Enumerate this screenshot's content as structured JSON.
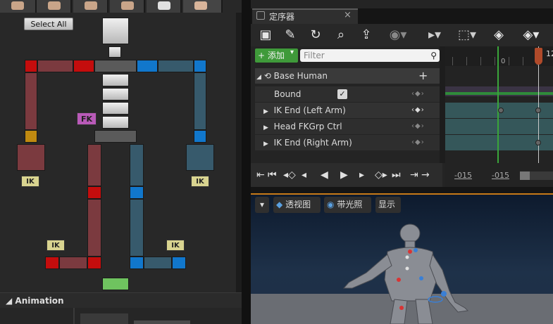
{
  "left_panel": {
    "select_all": "Select All",
    "fk_label": "FK",
    "ik_labels": [
      "IK",
      "IK",
      "IK",
      "IK"
    ],
    "animation_header": "Animation"
  },
  "sequencer": {
    "tab_title": "定序器",
    "close": "×",
    "add_label": "+ 添加",
    "filter_placeholder": "Filter",
    "root_track": "Base Human",
    "tracks": [
      {
        "label": "Bound",
        "checked": true
      },
      {
        "label": "IK End (Left Arm)"
      },
      {
        "label": "Head FKGrp Ctrl"
      },
      {
        "label": "IK End (Right Arm)"
      }
    ],
    "timeline_zero": "0",
    "timeline_partial": "12",
    "range_start": "-015",
    "range_end": "-015"
  },
  "viewport": {
    "perspective": "透视图",
    "lit": "带光照",
    "show": "显示"
  },
  "colors": {
    "ik_red": "#c40d0d",
    "ik_blue": "#1177cc",
    "add_green": "#3f9a3a",
    "fk_purple": "#b95ab8",
    "ik_yellow": "#d9d490"
  }
}
